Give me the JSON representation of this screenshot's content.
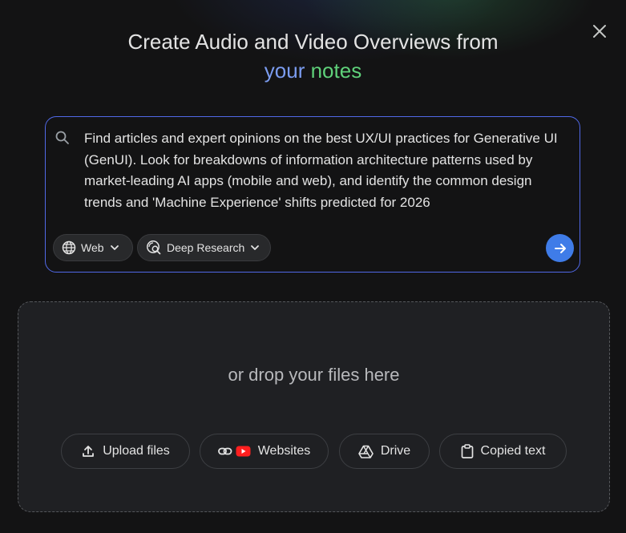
{
  "header": {
    "title_line1": "Create Audio and Video Overviews from",
    "title_line2_word1": "your",
    "title_line2_word2": "notes",
    "close_icon": "close-icon"
  },
  "search": {
    "icon": "search-icon",
    "query": "Find articles and expert opinions on the best UX/UI practices for Generative UI (GenUI). Look for breakdowns of information architecture patterns used by market-leading AI apps (mobile and web), and identify the common design trends and 'Machine Experience' shifts predicted for 2026",
    "source_chip": {
      "label": "Web",
      "icon": "globe-icon"
    },
    "mode_chip": {
      "label": "Deep Research",
      "icon": "deep-research-icon"
    },
    "submit_icon": "arrow-right-icon",
    "accent_color": "#5169e8",
    "submit_color": "#3f7ce8"
  },
  "dropzone": {
    "text": "or drop your files here",
    "buttons": [
      {
        "label": "Upload files",
        "icon": "upload-icon"
      },
      {
        "label": "Websites",
        "icon": "link-youtube-icon"
      },
      {
        "label": "Drive",
        "icon": "drive-icon"
      },
      {
        "label": "Copied text",
        "icon": "clipboard-icon"
      }
    ]
  }
}
